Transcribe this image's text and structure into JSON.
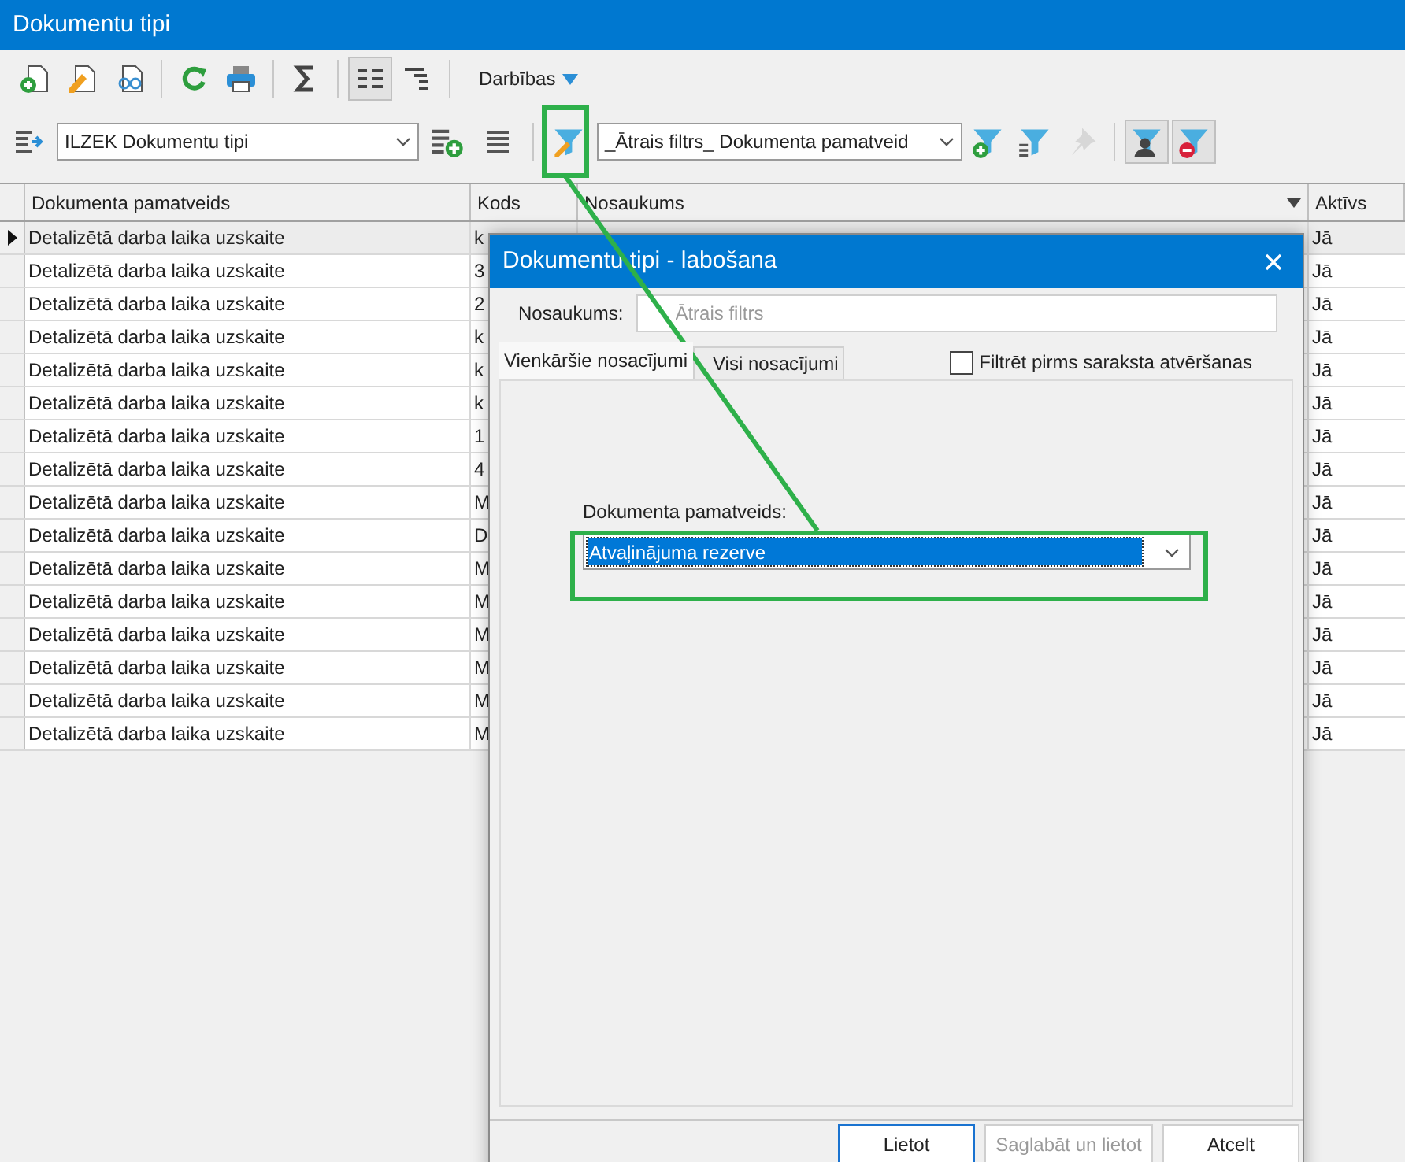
{
  "window": {
    "title": "Dokumentu tipi"
  },
  "toolbar": [
    {
      "kind": "new",
      "pressed": false,
      "disabled": false
    },
    {
      "kind": "edit",
      "pressed": false,
      "disabled": false
    },
    {
      "kind": "view",
      "pressed": false,
      "disabled": false
    },
    {
      "kind": "sep"
    },
    {
      "kind": "refresh",
      "pressed": false,
      "disabled": false
    },
    {
      "kind": "print",
      "pressed": false,
      "disabled": false
    },
    {
      "kind": "sep"
    },
    {
      "kind": "sum",
      "pressed": false,
      "disabled": false
    },
    {
      "kind": "sep"
    },
    {
      "kind": "grid",
      "pressed": true,
      "disabled": false
    },
    {
      "kind": "tree",
      "pressed": false,
      "disabled": false
    },
    {
      "kind": "sep"
    }
  ],
  "actions_menu": {
    "label": "Darbības"
  },
  "filter_bar": {
    "view_select": "ILZEK Dokumentu tipi",
    "filter_select": "_Ātrais filtrs_ Dokumenta pamatveid",
    "tools": [
      {
        "kind": "filter-add",
        "pressed": false,
        "disabled": false
      },
      {
        "kind": "filter-sort",
        "pressed": false,
        "disabled": false
      },
      {
        "kind": "filter-pin",
        "pressed": false,
        "disabled": true
      },
      {
        "kind": "sep"
      },
      {
        "kind": "filter-user",
        "pressed": true,
        "disabled": false
      },
      {
        "kind": "filter-remove",
        "pressed": true,
        "disabled": false
      }
    ]
  },
  "table": {
    "columns": [
      "Dokumenta pamatveids",
      "Kods",
      "Nosaukums",
      "Aktīvs"
    ],
    "rows": [
      {
        "selected": true,
        "cells": [
          "Detalizētā darba laika uzskaite",
          "k",
          "Jā"
        ]
      },
      {
        "selected": false,
        "cells": [
          "Detalizētā darba laika uzskaite",
          "3",
          "Jā"
        ]
      },
      {
        "selected": false,
        "cells": [
          "Detalizētā darba laika uzskaite",
          "2",
          "Jā"
        ]
      },
      {
        "selected": false,
        "cells": [
          "Detalizētā darba laika uzskaite",
          "k",
          "Jā"
        ]
      },
      {
        "selected": false,
        "cells": [
          "Detalizētā darba laika uzskaite",
          "k",
          "Jā"
        ]
      },
      {
        "selected": false,
        "cells": [
          "Detalizētā darba laika uzskaite",
          "k",
          "Jā"
        ]
      },
      {
        "selected": false,
        "cells": [
          "Detalizētā darba laika uzskaite",
          "1",
          "Jā"
        ]
      },
      {
        "selected": false,
        "cells": [
          "Detalizētā darba laika uzskaite",
          "4",
          "Jā"
        ]
      },
      {
        "selected": false,
        "cells": [
          "Detalizētā darba laika uzskaite",
          "M",
          "Jā"
        ]
      },
      {
        "selected": false,
        "cells": [
          "Detalizētā darba laika uzskaite",
          "D",
          "Jā"
        ]
      },
      {
        "selected": false,
        "cells": [
          "Detalizētā darba laika uzskaite",
          "M",
          "Jā"
        ]
      },
      {
        "selected": false,
        "cells": [
          "Detalizētā darba laika uzskaite",
          "M",
          "Jā"
        ]
      },
      {
        "selected": false,
        "cells": [
          "Detalizētā darba laika uzskaite",
          "M",
          "Jā"
        ]
      },
      {
        "selected": false,
        "cells": [
          "Detalizētā darba laika uzskaite",
          "M",
          "Jā"
        ]
      },
      {
        "selected": false,
        "cells": [
          "Detalizētā darba laika uzskaite",
          "M",
          "Jā"
        ]
      },
      {
        "selected": false,
        "cells": [
          "Detalizētā darba laika uzskaite",
          "M",
          "Jā"
        ]
      }
    ]
  },
  "dialog": {
    "title": "Dokumentu tipi - labošana",
    "name_label": "Nosaukums:",
    "name_placeholder": "Ātrais filtrs",
    "tabs": [
      {
        "label": "Vienkāršie nosacījumi",
        "selected": true
      },
      {
        "label": "Visi nosacījumi",
        "selected": false
      }
    ],
    "prefilter": {
      "label": "Filtrēt pirms saraksta atvēršanas",
      "checked": false
    },
    "field_label": "Dokumenta pamatveids:",
    "field_value": "Atvaļinājuma rezerve",
    "buttons": [
      {
        "label": "Lietot",
        "default": true,
        "disabled": false
      },
      {
        "label": "Saglabāt un lietot",
        "default": false,
        "disabled": true
      },
      {
        "label": "Atcelt",
        "default": false,
        "disabled": false
      }
    ]
  }
}
